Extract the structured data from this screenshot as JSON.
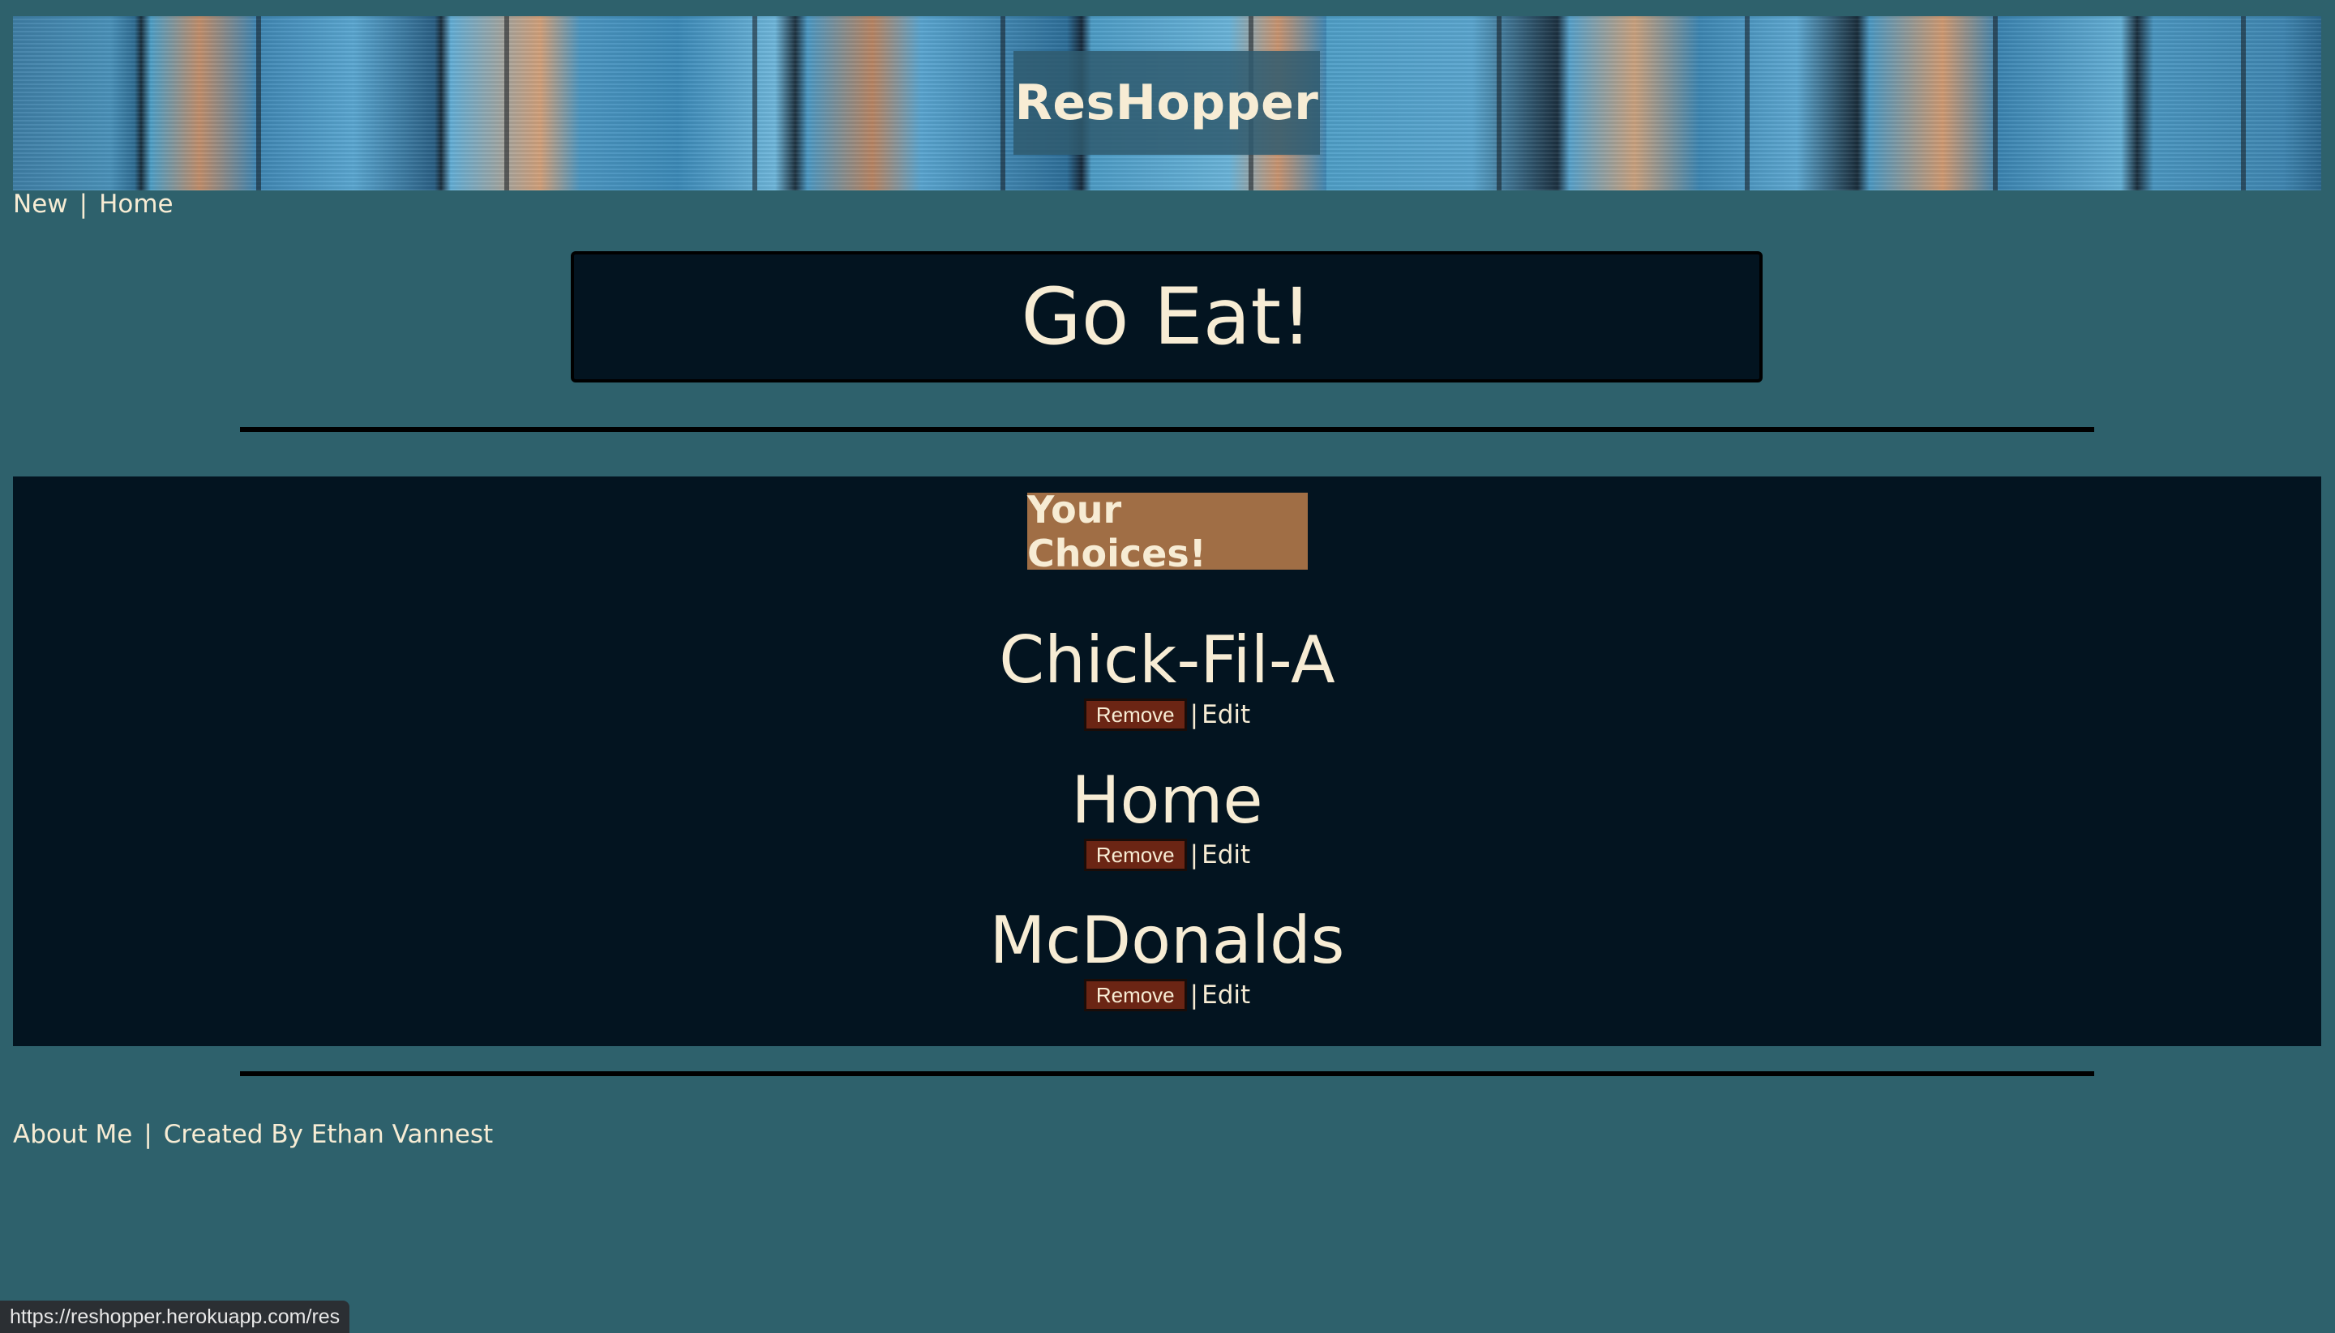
{
  "header": {
    "brand": "ResHopper"
  },
  "nav": {
    "new_label": "New",
    "separator": "|",
    "home_label": "Home"
  },
  "hero": {
    "title": "Go Eat!"
  },
  "choices": {
    "title": "Your Choices!",
    "items": [
      {
        "name": "Chick-Fil-A",
        "remove_label": "Remove",
        "separator": "|",
        "edit_label": "Edit"
      },
      {
        "name": "Home",
        "remove_label": "Remove",
        "separator": "|",
        "edit_label": "Edit"
      },
      {
        "name": "McDonalds",
        "remove_label": "Remove",
        "separator": "|",
        "edit_label": "Edit"
      }
    ]
  },
  "footer": {
    "about_label": "About Me",
    "separator": "|",
    "credit": "Created By Ethan Vannest"
  },
  "status": {
    "url": "https://reshopper.herokuapp.com/res"
  },
  "colors": {
    "page_bg": "#2e616c",
    "panel_bg": "#031420",
    "text": "#f7ecd4",
    "choices_title_bg": "#a06e45",
    "remove_button_bg": "#6b2514"
  }
}
